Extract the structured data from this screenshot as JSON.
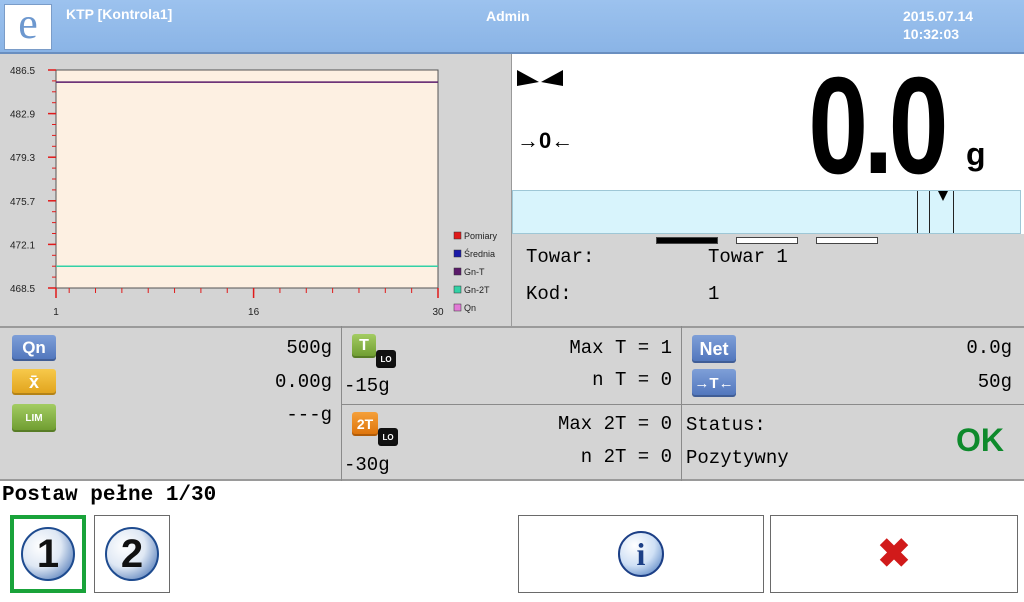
{
  "header": {
    "logo_letter": "e",
    "app_title": "KTP [Kontrola1]",
    "user": "Admin",
    "date": "2015.07.14",
    "time": "10:32:03"
  },
  "chart_data": {
    "type": "line",
    "y_ticks": [
      "486.5",
      "482.9",
      "479.3",
      "475.7",
      "472.1",
      "468.5"
    ],
    "x_ticks": [
      "1",
      "16",
      "30"
    ],
    "ylim": [
      468.5,
      486.5
    ],
    "xlim": [
      1,
      30
    ],
    "grid": false,
    "legend_position": "right",
    "series": [
      {
        "name": "Pomiary",
        "color": "#e01a1a",
        "values": []
      },
      {
        "name": "Średnia",
        "color": "#1a1aa8",
        "values": []
      },
      {
        "name": "Gn-T",
        "color": "#5a1a6a",
        "values": [
          485.5
        ]
      },
      {
        "name": "Gn-2T",
        "color": "#33d1a6",
        "values": [
          470.3
        ]
      },
      {
        "name": "Qn",
        "color": "#e27ad6",
        "values": []
      }
    ]
  },
  "weight": {
    "value": "0.0",
    "unit": "g",
    "zero_indicator": "→0←",
    "icons": [
      "stability-icon",
      "zero-icon"
    ]
  },
  "product": {
    "towar_label": "Towar:",
    "towar_value": "Towar 1",
    "kod_label": "Kod:",
    "kod_value": "1"
  },
  "stats": {
    "qn_badge": "Qn",
    "qn_value": "500g",
    "xbar_badge": "x̄",
    "xbar_value": "0.00g",
    "xbar_lim_badge": "LIM",
    "xbar_lim_value": "---g",
    "t_badge": "T",
    "t_lo": "LO",
    "t_value": "-15g",
    "max_t": "Max T = 1",
    "n_t": "n T = 0",
    "t2_badge": "2T",
    "t2_value": "-30g",
    "max_2t": "Max 2T = 0",
    "n_2t": "n 2T = 0",
    "net_badge": "Net",
    "net_value": "0.0g",
    "tare_badge": "→T←",
    "tare_value": "50g",
    "status_label": "Status:",
    "status_value": "Pozytywny",
    "status_ok": "OK"
  },
  "message": "Postaw pełne 1/30",
  "buttons": {
    "btn1_label": "1",
    "btn2_label": "2",
    "info_label": "i",
    "close_label": "✖"
  },
  "colors": {
    "header": "#8ab4e6",
    "ok": "#0e8a2c",
    "bargraph": "#d8f4fc",
    "selected": "#19a33a"
  }
}
